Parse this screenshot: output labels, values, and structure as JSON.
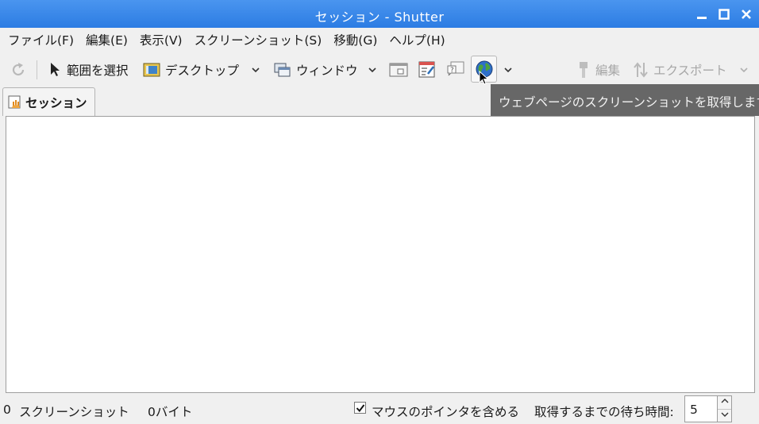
{
  "window": {
    "title": "セッション - Shutter"
  },
  "menu": {
    "items": [
      {
        "label": "ファイル(F)"
      },
      {
        "label": "編集(E)"
      },
      {
        "label": "表示(V)"
      },
      {
        "label": "スクリーンショット(S)"
      },
      {
        "label": "移動(G)"
      },
      {
        "label": "ヘルプ(H)"
      }
    ]
  },
  "toolbar": {
    "select_label": "範囲を選択",
    "desktop_label": "デスクトップ",
    "window_label": "ウィンドウ",
    "edit_label": "編集",
    "export_label": "エクスポート",
    "tooltip": "ウェブページのスクリーンショットを取得します"
  },
  "tabs": [
    {
      "label": "セッション"
    }
  ],
  "status": {
    "count": "0",
    "count_label": "スクリーンショット",
    "size": "0バイト",
    "mouse_pointer_label": "マウスのポインタを含める",
    "mouse_pointer_checked": true,
    "delay_label": "取得するまでの待ち時間:",
    "delay_value": "5"
  },
  "colors": {
    "titlebar": "#3a88ea",
    "tooltip_bg": "#676767"
  }
}
